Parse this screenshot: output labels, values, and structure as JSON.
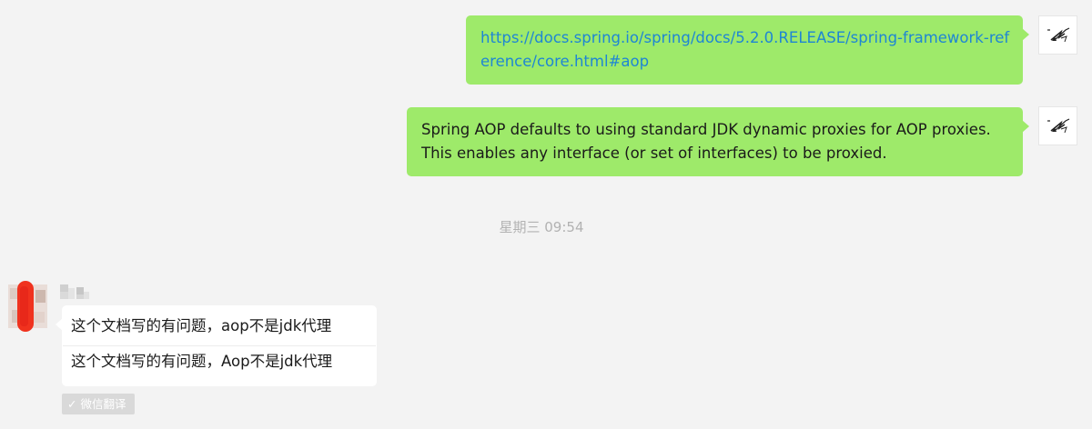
{
  "messages_outgoing": [
    {
      "type": "link",
      "url": "https://docs.spring.io/spring/docs/5.2.0.RELEASE/spring-framework-reference/core.html#aop",
      "text": "https://docs.spring.io/spring/docs/5.2.0.RELEASE/spring-framework-reference/core.html#aop"
    },
    {
      "type": "text",
      "line1": "Spring AOP defaults to using standard JDK dynamic proxies for AOP proxies.",
      "line2": "This enables any interface (or set of interfaces) to be proxied."
    }
  ],
  "timestamp": "星期三 09:54",
  "message_incoming": {
    "text": "这个文档写的有问题，aop不是jdk代理",
    "translation": "这个文档写的有问题，Aop不是jdk代理",
    "translate_badge": "微信翻译",
    "translate_check": "✓"
  },
  "colors": {
    "bubble_outgoing": "#9eea6a",
    "bubble_incoming": "#ffffff",
    "link": "#1e86d4",
    "background": "#f3f3f3",
    "timestamp": "#b2b2b2",
    "badge": "#d9d9d9"
  },
  "icons": {
    "self_avatar": "sketch-avatar-icon",
    "peer_avatar": "blurred-avatar-icon"
  }
}
